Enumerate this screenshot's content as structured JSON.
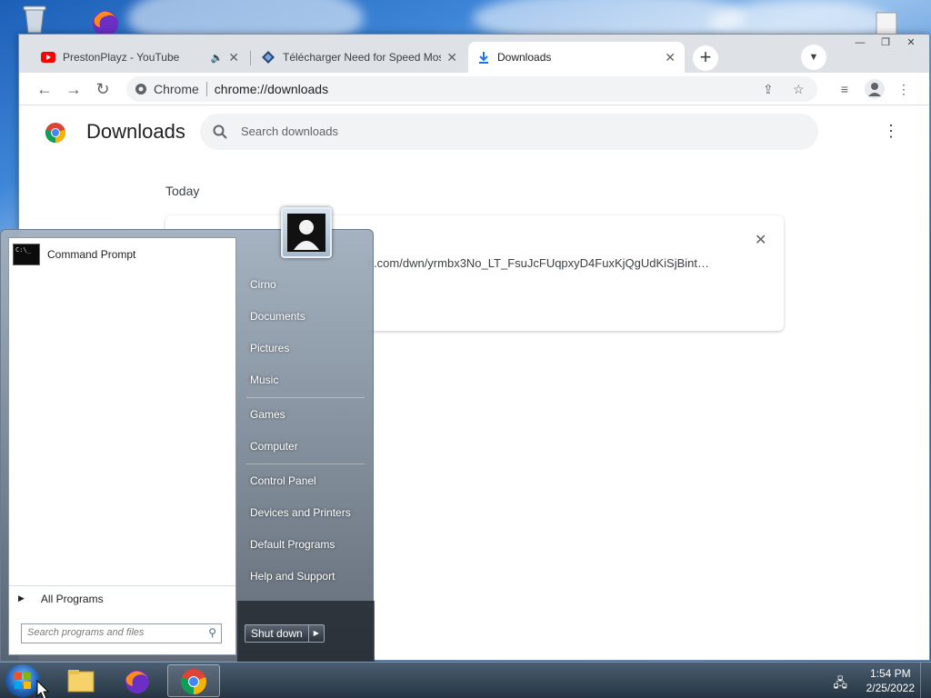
{
  "browser": {
    "tabs": [
      {
        "label": "PrestonPlayz - YouTube",
        "icon": "youtube-icon",
        "audio": true
      },
      {
        "label": "Télécharger Need for Speed Most Wanted",
        "icon": "site-icon"
      },
      {
        "label": "Downloads",
        "icon": "download-icon"
      }
    ],
    "omnibox": {
      "site": "Chrome",
      "url": "chrome://downloads"
    }
  },
  "downloads_page": {
    "title": "Downloads",
    "search_placeholder": "Search downloads",
    "section_label": "Today",
    "item": {
      "url": "n.com/dwn/yrmbx3No_LT_FsuJcFUqpxyD4FuxKjQgUdKiSjBint…"
    }
  },
  "start_menu": {
    "recent_programs": [
      {
        "label": "Command Prompt"
      }
    ],
    "all_programs_label": "All Programs",
    "search_placeholder": "Search programs and files",
    "right_items": [
      "Cirno",
      "Documents",
      "Pictures",
      "Music",
      "Games",
      "Computer",
      "Control Panel",
      "Devices and Printers",
      "Default Programs",
      "Help and Support"
    ],
    "shutdown_label": "Shut down"
  },
  "taskbar": {
    "time": "1:54 PM",
    "date": "2/25/2022"
  },
  "colors": {
    "chrome_tab_strip": "#dee1e6",
    "omnibox_bg": "#f1f3f4",
    "taskbar": "#263543"
  }
}
